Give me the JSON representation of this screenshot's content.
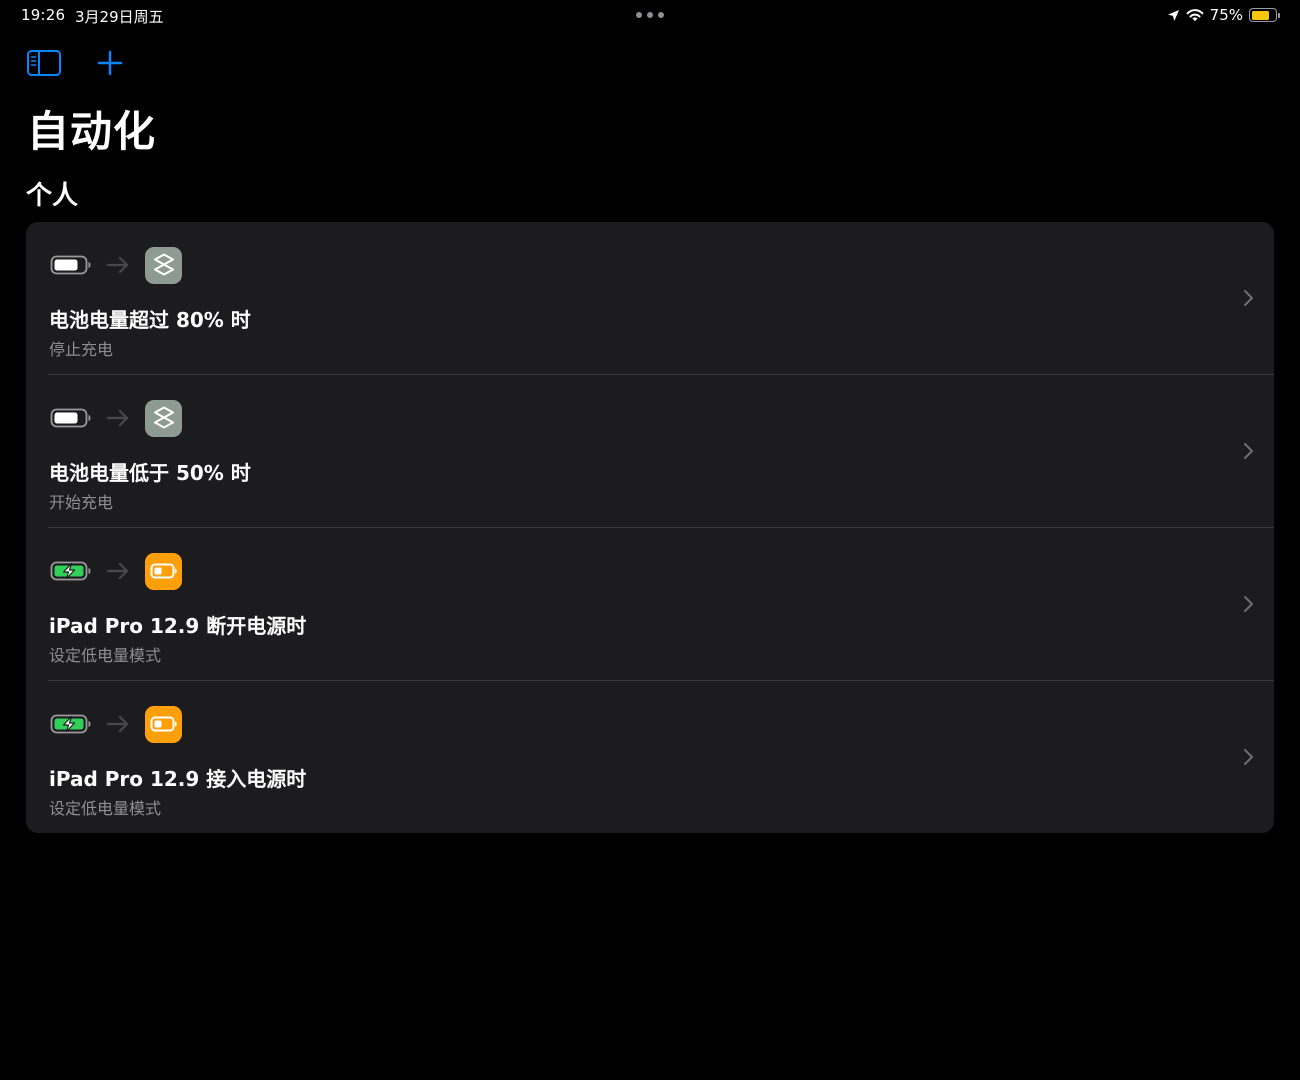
{
  "status_bar": {
    "time": "19:26",
    "date": "3月29日周五",
    "battery_percent": "75%",
    "battery_level": 0.75,
    "icons": [
      "location-arrow-icon",
      "wifi-icon",
      "battery-icon"
    ]
  },
  "toolbar": {
    "sidebar_icon": "sidebar-toggle-icon",
    "add_icon": "plus-icon",
    "accent_color": "#0a84ff"
  },
  "page": {
    "title": "自动化",
    "section_title": "个人"
  },
  "automations": [
    {
      "title": "电池电量超过 80% 时",
      "subtitle": "停止充电",
      "trigger_icon": "battery-full-icon",
      "action_icon": "shortcuts-app-icon"
    },
    {
      "title": "电池电量低于 50% 时",
      "subtitle": "开始充电",
      "trigger_icon": "battery-full-icon",
      "action_icon": "shortcuts-app-icon"
    },
    {
      "title": "iPad Pro 12.9 断开电源时",
      "subtitle": "设定低电量模式",
      "trigger_icon": "battery-charging-icon",
      "action_icon": "low-power-mode-icon"
    },
    {
      "title": "iPad Pro 12.9 接入电源时",
      "subtitle": "设定低电量模式",
      "trigger_icon": "battery-charging-icon",
      "action_icon": "low-power-mode-icon"
    }
  ],
  "colors": {
    "background": "#000000",
    "card": "#1c1c1e",
    "divider": "#38383a",
    "secondary_text": "#8e8e93",
    "shortcuts_icon_bg": "#8e9b92",
    "low_power_icon_bg": "#ff9f0a",
    "charging_green": "#30d158",
    "status_battery_yellow": "#f7c70a"
  }
}
